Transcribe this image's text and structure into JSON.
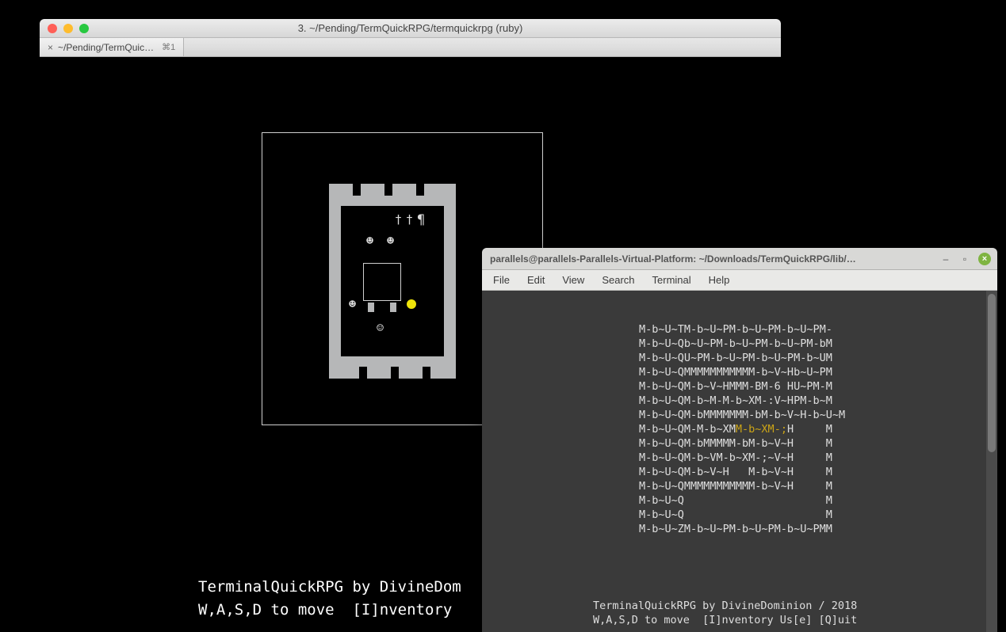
{
  "mac": {
    "title": "3. ~/Pending/TermQuickRPG/termquickrpg (ruby)",
    "tab": {
      "label": "~/Pending/TermQuic…",
      "shortcut": "⌘1"
    },
    "status_line1": "TerminalQuickRPG by DivineDom",
    "status_line2": "W,A,S,D to move  [I]nventory "
  },
  "game": {
    "glyphs": {
      "cross1": "†",
      "cross2": "†",
      "pilcrow": "¶",
      "face1": "☻",
      "face2": "☻",
      "face3": "☻",
      "face4": "☺"
    }
  },
  "linux": {
    "title": "parallels@parallels-Parallels-Virtual-Platform: ~/Downloads/TermQuickRPG/lib/…",
    "menu": [
      "File",
      "Edit",
      "View",
      "Search",
      "Terminal",
      "Help"
    ],
    "lines": [
      {
        "pre": "M-b~U~TM-b~U~PM-b~U~PM-b~U~PM-",
        "hl": "",
        "post": ""
      },
      {
        "pre": "M-b~U~Qb~U~PM-b~U~PM-b~U~PM-bM",
        "hl": "",
        "post": ""
      },
      {
        "pre": "M-b~U~QU~PM-b~U~PM-b~U~PM-b~UM",
        "hl": "",
        "post": ""
      },
      {
        "pre": "M-b~U~QMMMMMMMMMMM-b~V~Hb~U~PM",
        "hl": "",
        "post": ""
      },
      {
        "pre": "M-b~U~QM-b~V~HMMM-BM-6 HU~PM-M",
        "hl": "",
        "post": ""
      },
      {
        "pre": "M-b~U~QM-b~M-M-b~XM-:V~HPM-b~M",
        "hl": "",
        "post": ""
      },
      {
        "pre": "M-b~U~QM-bMMMMMMM-bM-b~V~H-b~U~M",
        "hl": "",
        "post": ""
      },
      {
        "pre": "M-b~U~QM-M-b~XM",
        "hl": "M-b~XM-;",
        "post": "H     M"
      },
      {
        "pre": "M-b~U~QM-bMMMMM-bM-b~V~H     M",
        "hl": "",
        "post": ""
      },
      {
        "pre": "M-b~U~QM-b~VM-b~XM-;~V~H     M",
        "hl": "",
        "post": ""
      },
      {
        "pre": "M-b~U~QM-b~V~H   M-b~V~H     M",
        "hl": "",
        "post": ""
      },
      {
        "pre": "M-b~U~QMMMMMMMMMMM-b~V~H     M",
        "hl": "",
        "post": ""
      },
      {
        "pre": "M-b~U~Q                      M",
        "hl": "",
        "post": ""
      },
      {
        "pre": "M-b~U~Q                      M",
        "hl": "",
        "post": ""
      },
      {
        "pre": "M-b~U~ZM-b~U~PM-b~U~PM-b~U~PMM",
        "hl": "",
        "post": ""
      }
    ],
    "footer_line1": "TerminalQuickRPG by DivineDominion / 2018",
    "footer_line2": "W,A,S,D to move  [I]nventory Us[e] [Q]uit"
  }
}
